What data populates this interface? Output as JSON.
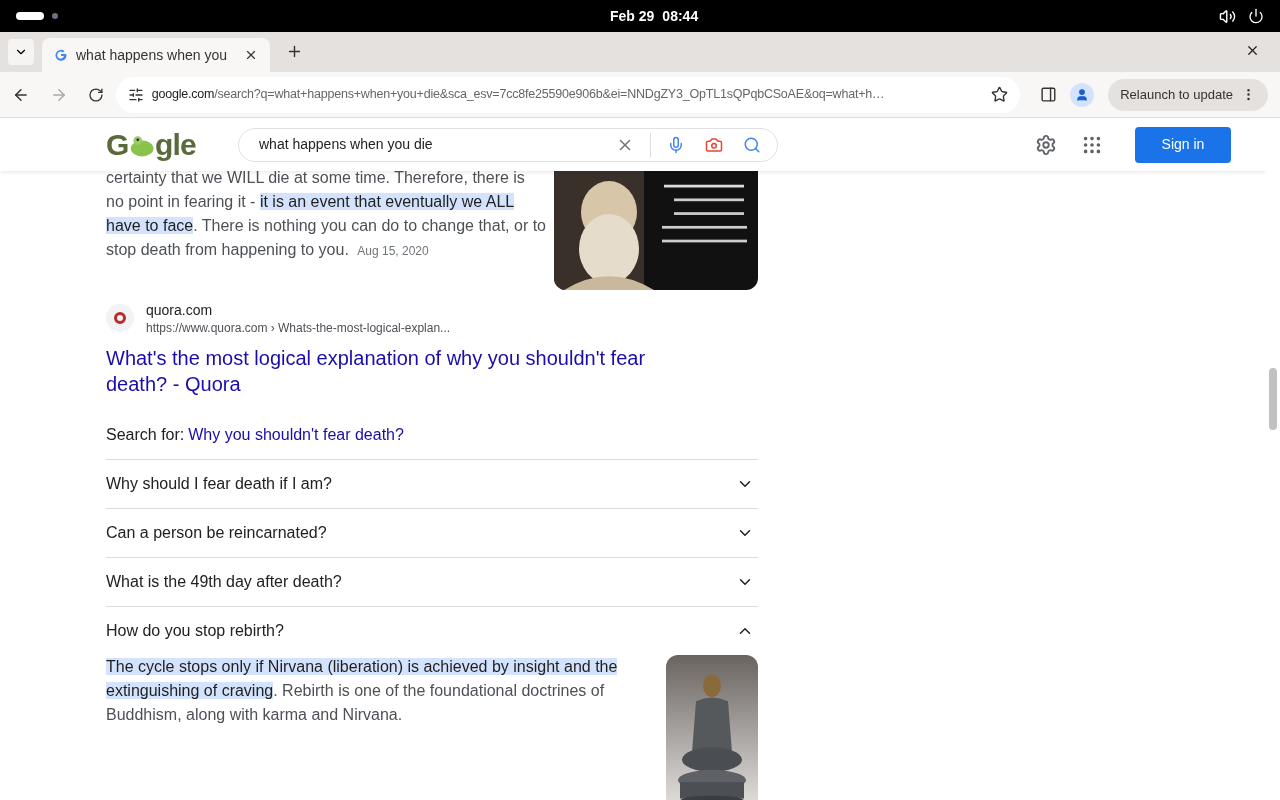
{
  "top_bar": {
    "date": "Feb 29",
    "time": "08:44"
  },
  "tabs": [
    {
      "title": "what happens when you",
      "selected": true
    }
  ],
  "address_bar": {
    "domain": "google.com",
    "path": "/search?q=what+happens+when+you+die&sca_esv=7cc8fe25590e906b&ei=NNDgZY3_OpTL1sQPqbCSoAE&oq=what+h…",
    "relaunch": "Relaunch to update"
  },
  "header": {
    "logo": {
      "left": "G",
      "right": "gle"
    },
    "query": "what happens when you die",
    "sign_in": "Sign in"
  },
  "snippet": {
    "segments": [
      {
        "text": "certainty that we WILL die at some time. Therefore, there is no point in fearing it - ",
        "highlighted": false
      },
      {
        "text": "it is an event that eventually we ALL have to face",
        "highlighted": true
      },
      {
        "text": ". There is nothing you can do to change that, or to stop death from happening to you.",
        "highlighted": false
      }
    ],
    "date": "Aug 15, 2020",
    "image": {
      "kind": "picture"
    }
  },
  "result": {
    "site": "quora.com",
    "url": "https://www.quora.com › Whats-the-most-logical-explan...",
    "title": "What's the most logical explanation of why you shouldn't fear death? - Quora"
  },
  "search_for": {
    "label": "Search for:",
    "link": "Why you shouldn't fear death?"
  },
  "questions": [
    {
      "question": "Why should I fear death if I am?",
      "expanded": false
    },
    {
      "question": "Can a person be reincarnated?",
      "expanded": false
    },
    {
      "question": "What is the 49th day after death?",
      "expanded": false
    },
    {
      "question": "How do you stop rebirth?",
      "expanded": true,
      "answer": [
        {
          "text": "The cycle stops only if Nirvana (liberation) is achieved by insight and the extinguishing of craving",
          "highlighted": true
        },
        {
          "text": ". Rebirth is one of the foundational doctrines of Buddhism, along with karma and Nirvana.",
          "highlighted": false
        }
      ],
      "image": {
        "kind": "picture"
      }
    }
  ]
}
